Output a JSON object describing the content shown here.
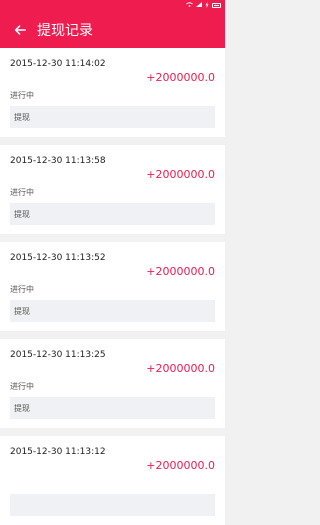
{
  "colors": {
    "accent": "#ee1c4f",
    "background": "#f1f1f1",
    "card": "#ffffff",
    "type_box": "#f0f1f4"
  },
  "status_bar": {
    "icons": [
      "wifi-icon",
      "signal-icon",
      "charging-icon",
      "battery-icon"
    ]
  },
  "header": {
    "back_icon": "arrow-left-icon",
    "title": "提现记录"
  },
  "records": [
    {
      "date": "2015-12-30 11:14:02",
      "amount": "+2000000.0",
      "status": "进行中",
      "type": "提现"
    },
    {
      "date": "2015-12-30 11:13:58",
      "amount": "+2000000.0",
      "status": "进行中",
      "type": "提现"
    },
    {
      "date": "2015-12-30 11:13:52",
      "amount": "+2000000.0",
      "status": "进行中",
      "type": "提现"
    },
    {
      "date": "2015-12-30 11:13:25",
      "amount": "+2000000.0",
      "status": "进行中",
      "type": "提现"
    },
    {
      "date": "2015-12-30 11:13:12",
      "amount": "+2000000.0",
      "status": "",
      "type": ""
    }
  ]
}
